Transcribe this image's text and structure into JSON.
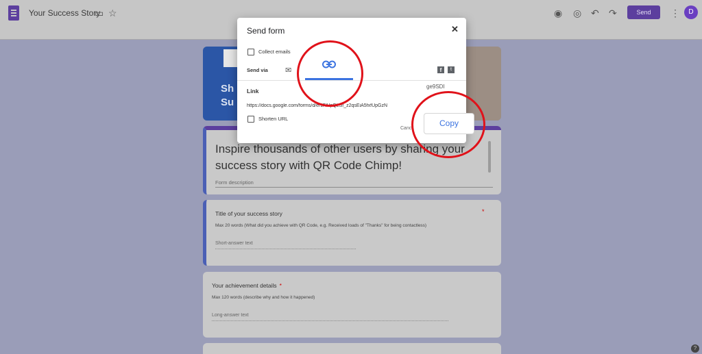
{
  "topbar": {
    "title": "Your Success Story",
    "send_label": "Send",
    "avatar_letter": "D",
    "icons": [
      "folder-icon",
      "star-icon",
      "palette-icon",
      "eye-icon",
      "undo-icon",
      "redo-icon",
      "more-vert-icon"
    ]
  },
  "form": {
    "header_text": "Sh\nSu",
    "title_text": "Inspire thousands of other users by sharing your success story with QR Code Chimp!",
    "description_placeholder": "Form description",
    "questions": [
      {
        "title": "Title of your success story",
        "required": "*",
        "help": "Max 20 words (What did you achieve with QR Code, e.g. Received loads of \"Thanks\" for being contactless)",
        "answer_placeholder": "Short-answer text"
      },
      {
        "title": "Your achievement details",
        "required": "*",
        "help": "Max 120 words (describe why and how it happened)",
        "answer_placeholder": "Long-answer text"
      }
    ]
  },
  "dialog": {
    "title": "Send form",
    "close": "✕",
    "collect_emails_label": "Collect emails",
    "send_via_label": "Send via",
    "link_label": "Link",
    "url": "https://docs.google.com/forms/d/e/1FAIpQLSf_z2qsEiA5fxfUpGzN",
    "url_tail": "ge9SDI",
    "shorten_url_label": "Shorten URL",
    "cancel_label": "Canc",
    "copy_label": "Copy"
  },
  "colors": {
    "accent": "#3b73e0",
    "brand": "#5c3f9e",
    "annotation": "#e0121a"
  }
}
